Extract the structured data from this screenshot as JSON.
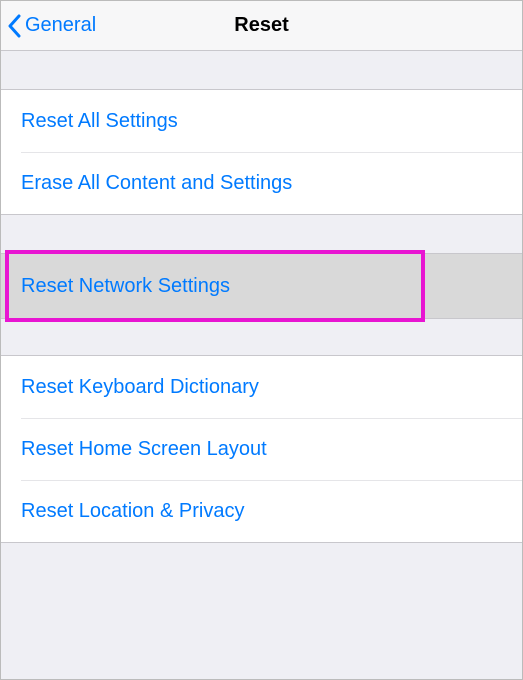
{
  "navbar": {
    "back_label": "General",
    "title": "Reset"
  },
  "sections": {
    "group1": {
      "reset_all": "Reset All Settings",
      "erase_all": "Erase All Content and Settings"
    },
    "group2": {
      "reset_network": "Reset Network Settings"
    },
    "group3": {
      "reset_keyboard": "Reset Keyboard Dictionary",
      "reset_home": "Reset Home Screen Layout",
      "reset_location": "Reset Location & Privacy"
    }
  },
  "colors": {
    "link": "#007aff",
    "highlight": "#e815d2",
    "background": "#efeff4"
  }
}
